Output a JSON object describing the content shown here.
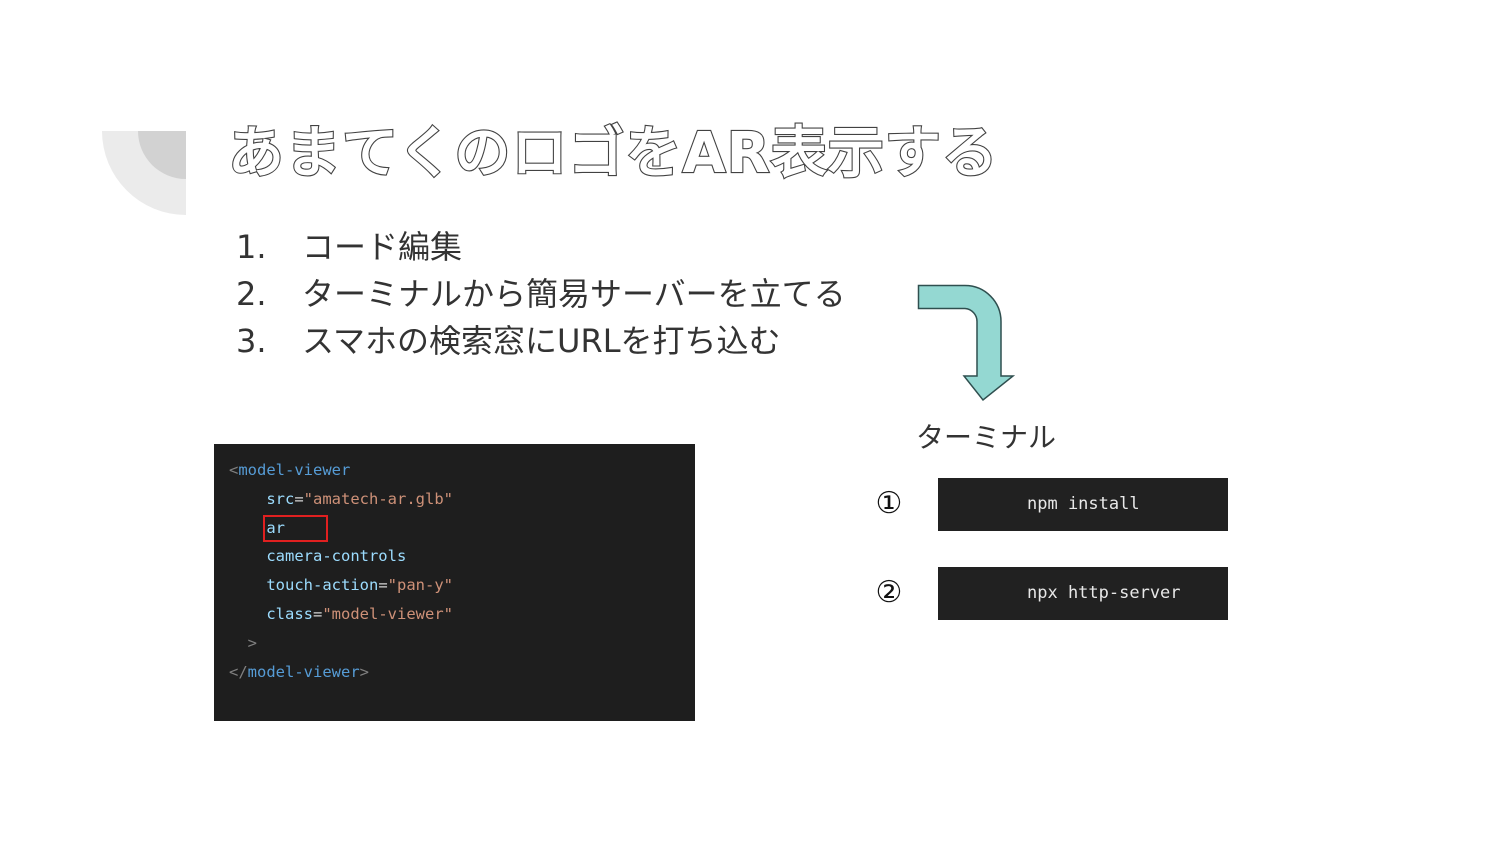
{
  "slide": {
    "title": "あまてくのロゴをAR表示する",
    "steps": [
      {
        "num": "1.",
        "text": "コード編集"
      },
      {
        "num": "2.",
        "text": "ターミナルから簡易サーバーを立てる"
      },
      {
        "num": "3.",
        "text": "スマホの検索窓にURLを打ち込む"
      }
    ],
    "code": {
      "open_bracket": "<",
      "tag": "model-viewer",
      "attr_src": "src",
      "eq": "=",
      "val_src": "\"amatech-ar.glb\"",
      "attr_ar": "ar",
      "attr_camera": "camera-controls",
      "attr_touch": "touch-action",
      "val_touch": "\"pan-y\"",
      "attr_class": "class",
      "val_class": "\"model-viewer\"",
      "close_gt": ">",
      "close_open": "</",
      "close_tag": "model-viewer",
      "close_end": ">"
    },
    "terminal": {
      "label": "ターミナル",
      "commands": [
        {
          "marker": "①",
          "command": "npm install"
        },
        {
          "marker": "②",
          "command": "npx http-server"
        }
      ]
    },
    "colors": {
      "arrow_fill": "#94d8d2",
      "code_bg": "#1e1e1e",
      "highlight_border": "#e02020"
    }
  }
}
